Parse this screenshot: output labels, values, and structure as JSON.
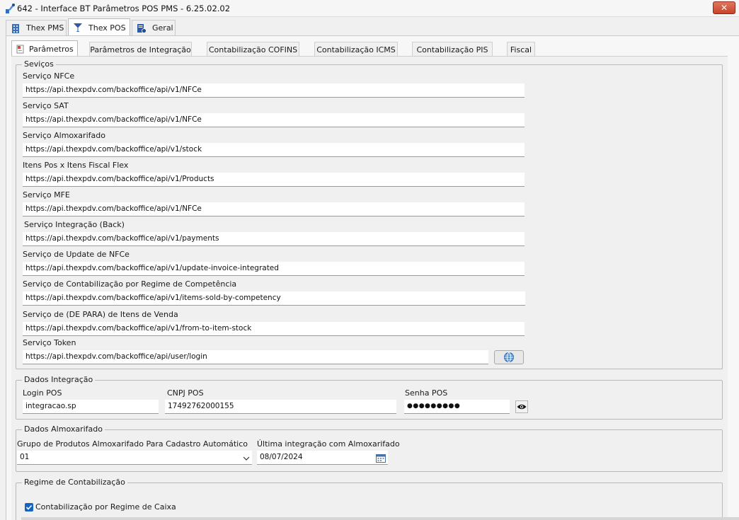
{
  "window": {
    "title": "642 - Interface BT Parâmetros POS PMS - 6.25.02.02",
    "close_glyph": "✕"
  },
  "top_tabs": [
    {
      "label": "Thex PMS",
      "icon": "building-icon"
    },
    {
      "label": "Thex POS",
      "icon": "cocktail-icon"
    },
    {
      "label": "Geral",
      "icon": "settings-document-icon"
    }
  ],
  "sub_tabs": [
    {
      "label": "Parâmetros"
    },
    {
      "label": "Parâmetros de Integração"
    },
    {
      "label": "Contabilização COFINS"
    },
    {
      "label": "Contabilização ICMS"
    },
    {
      "label": "Contabilização PIS"
    },
    {
      "label": "Fiscal"
    }
  ],
  "services": {
    "legend": "Seviços",
    "fields": [
      {
        "label": "Serviço NFCe",
        "value": "https://api.thexpdv.com/backoffice/api/v1/NFCe"
      },
      {
        "label": "Serviço SAT",
        "value": "https://api.thexpdv.com/backoffice/api/v1/NFCe"
      },
      {
        "label": "Serviço Almoxarifado",
        "value": "https://api.thexpdv.com/backoffice/api/v1/stock"
      },
      {
        "label": "Itens Pos x Itens Fiscal Flex",
        "value": "https://api.thexpdv.com/backoffice/api/v1/Products"
      },
      {
        "label": "Serviço MFE",
        "value": "https://api.thexpdv.com/backoffice/api/v1/NFCe"
      },
      {
        "label": "Serviço Integração (Back)",
        "value": "https://api.thexpdv.com/backoffice/api/v1/payments"
      },
      {
        "label": "Serviço de Update de NFCe",
        "value": "https://api.thexpdv.com/backoffice/api/v1/update-invoice-integrated"
      },
      {
        "label": "Serviço de Contabilização por Regime de Competência",
        "value": "https://api.thexpdv.com/backoffice/api/v1/items-sold-by-competency"
      },
      {
        "label": "Serviço de (DE PARA) de Itens de Venda",
        "value": "https://api.thexpdv.com/backoffice/api/v1/from-to-item-stock"
      },
      {
        "label": "Serviço Token",
        "value": "https://api.thexpdv.com/backoffice/api/user/login"
      }
    ]
  },
  "integration": {
    "legend": "Dados Integração",
    "login_label": "Login POS",
    "login_value": "integracao.sp",
    "cnpj_label": "CNPJ POS",
    "cnpj_value": "17492762000155",
    "password_label": "Senha POS",
    "password_value": "●●●●●●●●●"
  },
  "warehouse": {
    "legend": "Dados Almoxarifado",
    "group_label": "Grupo de Produtos Almoxarifado Para Cadastro Automático",
    "group_value": "01",
    "last_label": "Última integração com Almoxarifado",
    "last_value": "08/07/2024"
  },
  "regime": {
    "legend": "Regime de Contabilização",
    "checkbox_label": "Contabilização por Regime de Caixa",
    "checked": true
  },
  "colors": {
    "accent": "#1565c0",
    "close": "#c7432a"
  }
}
